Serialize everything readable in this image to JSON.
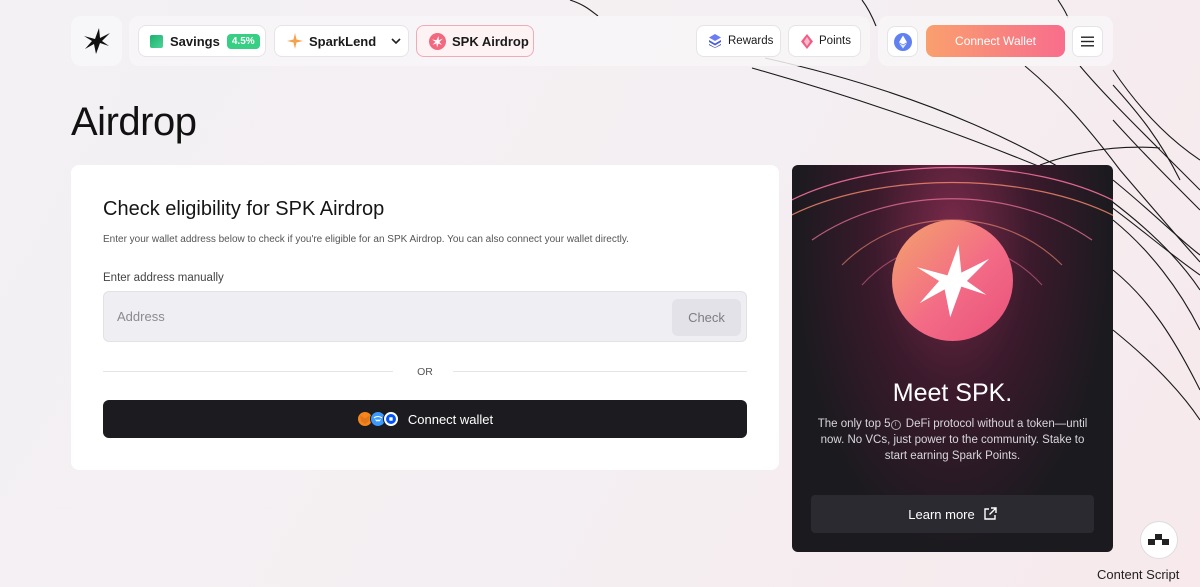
{
  "header": {
    "nav": {
      "savings_label": "Savings",
      "savings_badge": "4.5%",
      "sparklend_label": "SparkLend",
      "airdrop_label": "SPK Airdrop",
      "rewards_label": "Rewards",
      "points_label": "Points"
    },
    "connect_wallet_label": "Connect Wallet",
    "icons": {
      "logo": "spark-star-icon",
      "network": "ethereum-icon",
      "menu": "hamburger-menu-icon"
    }
  },
  "page": {
    "title": "Airdrop"
  },
  "eligibility_card": {
    "title": "Check eligibility for SPK Airdrop",
    "description": "Enter your wallet address below to check if you're eligible for an SPK Airdrop. You can also connect your wallet directly.",
    "field_label": "Enter address manually",
    "address_placeholder": "Address",
    "address_value": "",
    "check_label": "Check",
    "or_label": "OR",
    "connect_wallet_label": "Connect wallet"
  },
  "promo": {
    "title": "Meet SPK.",
    "text_before": "The only top 5",
    "text_after": " DeFi protocol without a token—until now. No VCs, just power to the community. Stake to start earning Spark Points.",
    "info_glyph": "i",
    "learn_more_label": "Learn more"
  },
  "extension": {
    "label": "Content Script"
  },
  "colors": {
    "accent_gradient_start": "#f9a06e",
    "accent_gradient_end": "#f86d8c",
    "savings_badge": "#36cf84",
    "dark_button": "#1c1b20"
  }
}
